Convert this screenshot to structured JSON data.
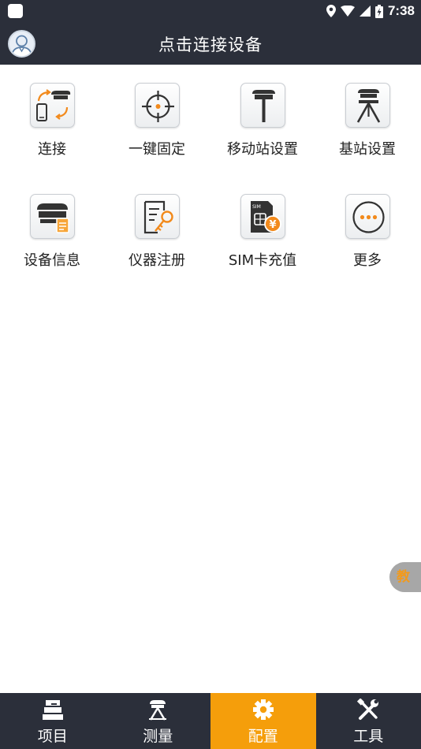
{
  "status_bar": {
    "time": "7:38"
  },
  "header": {
    "title": "点击连接设备"
  },
  "grid": [
    {
      "label": "连接",
      "icon": "connect-icon"
    },
    {
      "label": "一键固定",
      "icon": "crosshair-fix-icon"
    },
    {
      "label": "移动站设置",
      "icon": "rover-antenna-icon"
    },
    {
      "label": "基站设置",
      "icon": "base-station-tripod-icon"
    },
    {
      "label": "设备信息",
      "icon": "device-info-icon"
    },
    {
      "label": "仪器注册",
      "icon": "instrument-register-key-icon"
    },
    {
      "label": "SIM卡充值",
      "icon": "sim-recharge-icon"
    },
    {
      "label": "更多",
      "icon": "more-icon"
    }
  ],
  "tutorial_tab": {
    "label": "教"
  },
  "bottom_nav": [
    {
      "label": "项目",
      "icon": "project-icon",
      "active": false
    },
    {
      "label": "测量",
      "icon": "survey-icon",
      "active": false
    },
    {
      "label": "配置",
      "icon": "config-gear-icon",
      "active": true
    },
    {
      "label": "工具",
      "icon": "tools-icon",
      "active": false
    }
  ],
  "colors": {
    "bar": "#2b2f3a",
    "accent": "#f59e0b",
    "tutorial_tab": "#a7a7a7"
  }
}
